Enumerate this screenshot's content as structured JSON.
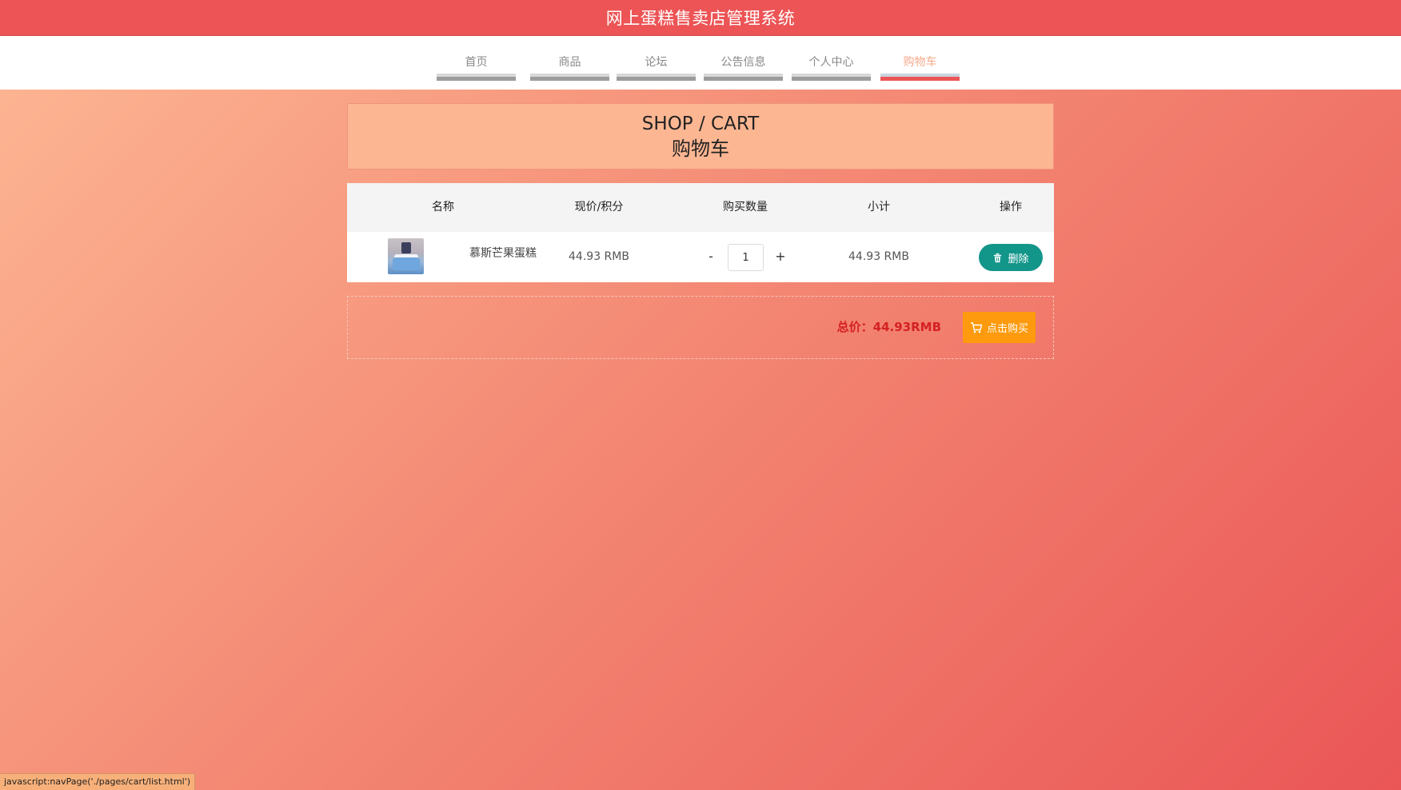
{
  "header": {
    "title": "网上蛋糕售卖店管理系统"
  },
  "nav": {
    "items": [
      {
        "label": "首页"
      },
      {
        "label": "商品"
      },
      {
        "label": "论坛"
      },
      {
        "label": "公告信息"
      },
      {
        "label": "个人中心"
      },
      {
        "label": "购物车"
      }
    ],
    "active": "购物车"
  },
  "page_heading": {
    "en": "SHOP / CART",
    "cn": "购物车"
  },
  "cart": {
    "columns": [
      "名称",
      "现价/积分",
      "购买数量",
      "小计",
      "操作"
    ],
    "rows": [
      {
        "image": "cake-thumbnail",
        "name": "慕斯芒果蛋糕",
        "price": "44.93 RMB",
        "quantity_minus": "-",
        "quantity": "1",
        "quantity_plus": "+",
        "subtotal": "44.93 RMB",
        "delete_label": "删除"
      }
    ]
  },
  "summary": {
    "total_label": "总价：44.93RMB",
    "buy_label": "点击购买"
  },
  "status_bar": {
    "text": "javascript:navPage('./pages/cart/list.html')"
  },
  "colors": {
    "top_bar": "#ec5455",
    "active_nav_text": "#f6a989",
    "delete_button": "#13968a",
    "buy_button": "#fd9a0d",
    "total_text": "#d42121"
  }
}
